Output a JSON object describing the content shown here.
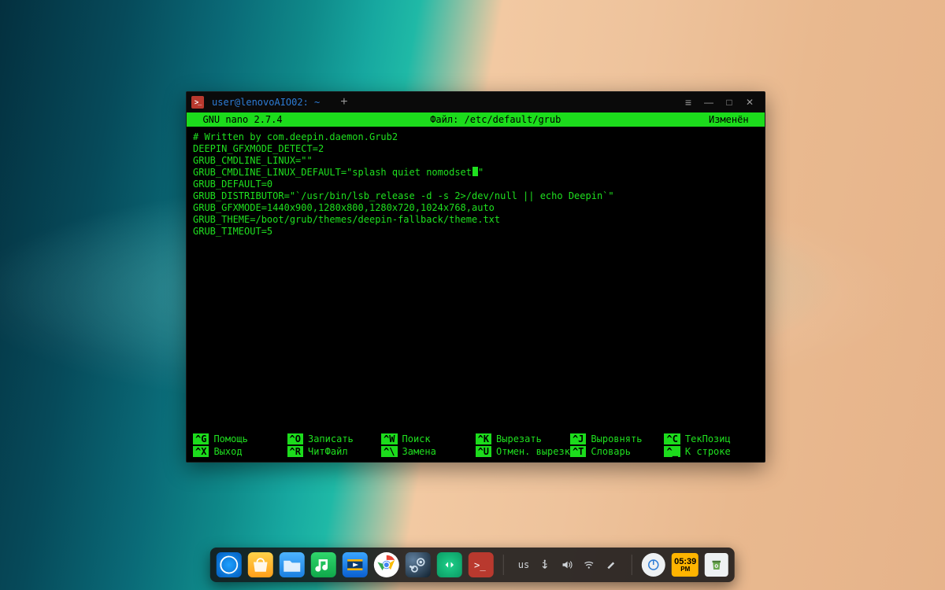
{
  "window": {
    "title": "user@lenovoAIO02: ~",
    "new_tab_glyph": "+",
    "menu_glyph": "≡",
    "minimize_glyph": "—",
    "maximize_glyph": "□",
    "close_glyph": "✕"
  },
  "nano": {
    "header_left": "  GNU nano 2.7.4",
    "header_center": "Файл: /etc/default/grub",
    "header_right": "Изменён  ",
    "lines": [
      "# Written by com.deepin.daemon.Grub2",
      "DEEPIN_GFXMODE_DETECT=2",
      "GRUB_CMDLINE_LINUX=\"\"",
      "GRUB_CMDLINE_LINUX_DEFAULT=\"splash quiet nomodset",
      "GRUB_DEFAULT=0",
      "GRUB_DISTRIBUTOR=\"`/usr/bin/lsb_release -d -s 2>/dev/null || echo Deepin`\"",
      "GRUB_GFXMODE=1440x900,1280x800,1280x720,1024x768,auto",
      "GRUB_THEME=/boot/grub/themes/deepin-fallback/theme.txt",
      "GRUB_TIMEOUT=5"
    ],
    "cursor_line_index": 3,
    "shortcuts": [
      {
        "key": "^G",
        "label": "Помощь"
      },
      {
        "key": "^O",
        "label": "Записать"
      },
      {
        "key": "^W",
        "label": "Поиск"
      },
      {
        "key": "^K",
        "label": "Вырезать"
      },
      {
        "key": "^J",
        "label": "Выровнять"
      },
      {
        "key": "^C",
        "label": "ТекПозиц"
      },
      {
        "key": "^X",
        "label": "Выход"
      },
      {
        "key": "^R",
        "label": "ЧитФайл"
      },
      {
        "key": "^\\",
        "label": "Замена"
      },
      {
        "key": "^U",
        "label": "Отмен. вырезк"
      },
      {
        "key": "^T",
        "label": "Словарь"
      },
      {
        "key": "^_",
        "label": "К строке"
      }
    ]
  },
  "dock": {
    "apps": [
      "deepin-logo",
      "app-store",
      "file-manager",
      "music",
      "movie",
      "chrome",
      "steam",
      "editor",
      "terminal"
    ],
    "tray": {
      "keyboard_layout": "us",
      "icons": [
        "usb",
        "volume",
        "wifi",
        "usb2"
      ]
    },
    "clock": {
      "time": "05:39",
      "suffix": "PM"
    }
  }
}
